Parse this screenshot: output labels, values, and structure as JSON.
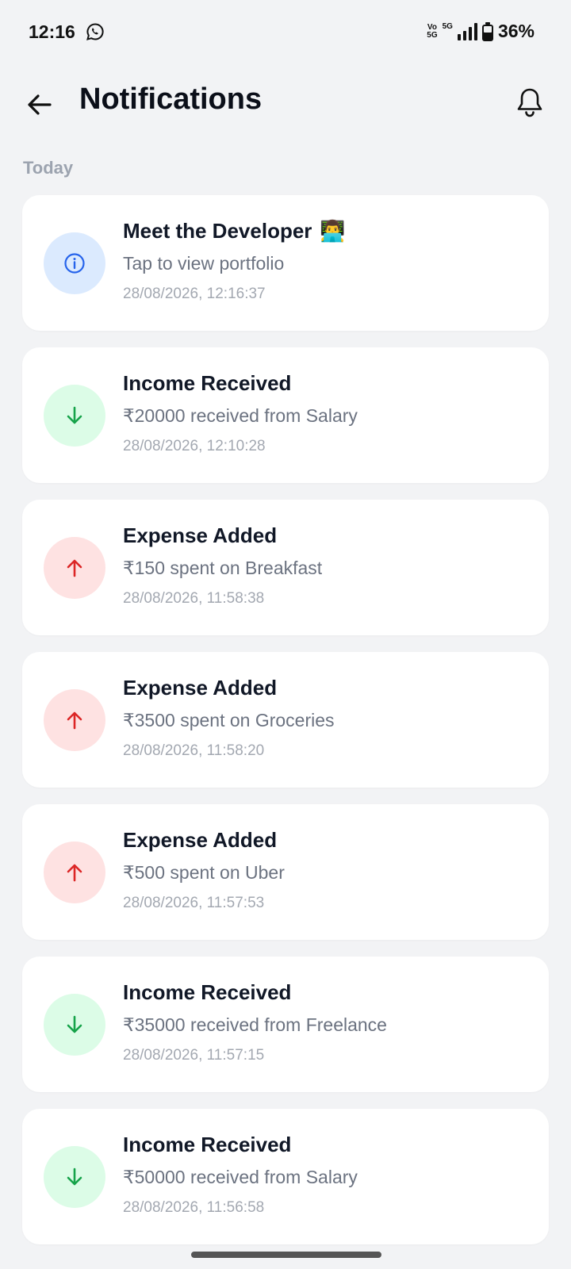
{
  "status_bar": {
    "time": "12:16",
    "volte": "Vo\n5G",
    "network": "5G",
    "battery": "36%"
  },
  "header": {
    "title": "Notifications"
  },
  "section": {
    "label": "Today"
  },
  "notifications": [
    {
      "type": "info",
      "title": "Meet the Developer",
      "emoji": "👨‍💻",
      "description": "Tap to view portfolio",
      "timestamp": "28/08/2026, 12:16:37"
    },
    {
      "type": "income",
      "title": "Income Received",
      "description": "₹20000 received from Salary",
      "timestamp": "28/08/2026, 12:10:28"
    },
    {
      "type": "expense",
      "title": "Expense Added",
      "description": "₹150 spent on Breakfast",
      "timestamp": "28/08/2026, 11:58:38"
    },
    {
      "type": "expense",
      "title": "Expense Added",
      "description": "₹3500 spent on Groceries",
      "timestamp": "28/08/2026, 11:58:20"
    },
    {
      "type": "expense",
      "title": "Expense Added",
      "description": "₹500 spent on Uber",
      "timestamp": "28/08/2026, 11:57:53"
    },
    {
      "type": "income",
      "title": "Income Received",
      "description": "₹35000 received from Freelance",
      "timestamp": "28/08/2026, 11:57:15"
    },
    {
      "type": "income",
      "title": "Income Received",
      "description": "₹50000 received from Salary",
      "timestamp": "28/08/2026, 11:56:58"
    }
  ],
  "colors": {
    "info": "#2563eb",
    "income": "#16a34a",
    "expense": "#dc2626"
  }
}
